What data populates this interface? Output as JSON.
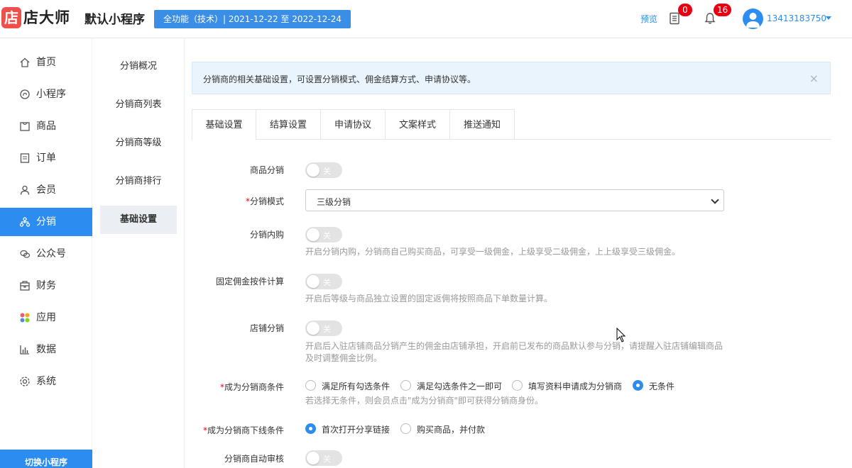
{
  "header": {
    "logo_char": "店",
    "brand": "店大师",
    "app_name": "默认小程序",
    "plan_badge": "全功能（技术）| 2021-12-22 至 2022-12-24",
    "preview": "预览",
    "orders_badge": "0",
    "notify_badge": "16",
    "phone": "13413183750"
  },
  "nav": {
    "items": [
      {
        "label": "首页",
        "icon": "home-icon"
      },
      {
        "label": "小程序",
        "icon": "miniapp-icon"
      },
      {
        "label": "商品",
        "icon": "goods-icon"
      },
      {
        "label": "订单",
        "icon": "order-icon"
      },
      {
        "label": "会员",
        "icon": "member-icon"
      },
      {
        "label": "分销",
        "icon": "distribution-icon"
      },
      {
        "label": "公众号",
        "icon": "wechat-icon"
      },
      {
        "label": "财务",
        "icon": "finance-icon"
      },
      {
        "label": "应用",
        "icon": "apps-icon"
      },
      {
        "label": "数据",
        "icon": "data-icon"
      },
      {
        "label": "系统",
        "icon": "system-icon"
      }
    ],
    "active": "分销",
    "switch_label": "切换小程序"
  },
  "subnav": {
    "items": [
      "分销概况",
      "分销商列表",
      "分销商等级",
      "分销商排行",
      "基础设置"
    ],
    "active": "基础设置"
  },
  "tip": {
    "text": "分销商的相关基础设置，可设置分销模式、佣金结算方式、申请协议等。",
    "close": "×"
  },
  "tabs": [
    "基础设置",
    "结算设置",
    "申请协议",
    "文案样式",
    "推送通知"
  ],
  "active_tab": "基础设置",
  "form": {
    "goods_distribution": {
      "label": "商品分销",
      "state": "关"
    },
    "mode": {
      "label": "分销模式",
      "value": "三级分销"
    },
    "inner_buy": {
      "label": "分销内购",
      "state": "关",
      "help": "开启分销内购，分销商自己购买商品，可享受一级佣金，上级享受二级佣金，上上级享受三级佣金。"
    },
    "fixed_commission": {
      "label": "固定佣金按件计算",
      "state": "关",
      "help": "开启后等级与商品独立设置的固定返佣将按照商品下单数量计算。"
    },
    "shop_distribution": {
      "label": "店铺分销",
      "state": "关",
      "help_line1": "开启后入驻店铺商品分销产生的佣金由店铺承担，开启前已发布的商品默认参与分销，请提醒入驻店铺编辑商品",
      "help_line2": "及时调整佣金比例。"
    },
    "become_condition": {
      "label": "成为分销商条件",
      "options": [
        "满足所有勾选条件",
        "满足勾选条件之一即可",
        "填写资料申请成为分销商",
        "无条件"
      ],
      "selected": "无条件",
      "help": "若选择无条件，则会员点击\"成为分销商\"即可获得分销商身份。"
    },
    "downline_condition": {
      "label": "成为分销商下线条件",
      "options": [
        "首次打开分享链接",
        "购买商品，并付款"
      ],
      "selected": "首次打开分享链接"
    },
    "auto_review": {
      "label": "分销商自动审核",
      "state": "关"
    }
  },
  "colors": {
    "primary": "#2d8cf0",
    "badge": "#e60012",
    "logo": "#f0504a"
  }
}
